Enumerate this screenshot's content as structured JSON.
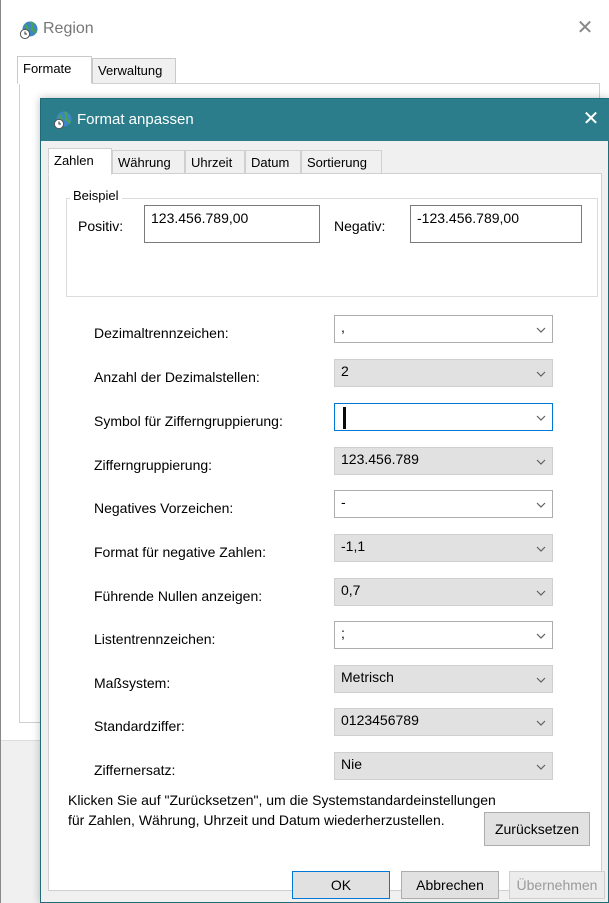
{
  "region": {
    "title": "Region",
    "tabs": [
      {
        "label": "Formate",
        "active": true
      },
      {
        "label": "Verwaltung",
        "active": false
      }
    ]
  },
  "dialog": {
    "title": "Format anpassen",
    "tabs": [
      {
        "label": "Zahlen",
        "active": true
      },
      {
        "label": "Währung",
        "active": false
      },
      {
        "label": "Uhrzeit",
        "active": false
      },
      {
        "label": "Datum",
        "active": false
      },
      {
        "label": "Sortierung",
        "active": false
      }
    ],
    "example": {
      "group_label": "Beispiel",
      "positive_label": "Positiv:",
      "positive_value": "123.456.789,00",
      "negative_label": "Negativ:",
      "negative_value": "-123.456.789,00"
    },
    "settings": [
      {
        "label": "Dezimaltrennzeichen:",
        "value": ",",
        "style": "white"
      },
      {
        "label": "Anzahl der Dezimalstellen:",
        "value": "2",
        "style": "gray"
      },
      {
        "label": "Symbol für Zifferngruppierung:",
        "value": "",
        "style": "focus"
      },
      {
        "label": "Zifferngruppierung:",
        "value": "123.456.789",
        "style": "gray"
      },
      {
        "label": "Negatives Vorzeichen:",
        "value": "-",
        "style": "white"
      },
      {
        "label": "Format für negative Zahlen:",
        "value": "-1,1",
        "style": "gray"
      },
      {
        "label": "Führende Nullen anzeigen:",
        "value": "0,7",
        "style": "gray"
      },
      {
        "label": "Listentrennzeichen:",
        "value": ";",
        "style": "white"
      },
      {
        "label": "Maßsystem:",
        "value": "Metrisch",
        "style": "gray"
      },
      {
        "label": "Standardziffer:",
        "value": "0123456789",
        "style": "gray"
      },
      {
        "label": "Ziffernersatz:",
        "value": "Nie",
        "style": "gray"
      }
    ],
    "reset_text": "Klicken Sie auf \"Zurücksetzen\", um die Systemstandardeinstellungen für Zahlen, Währung, Uhrzeit und Datum wiederherzustellen.",
    "buttons": {
      "reset": "Zurücksetzen",
      "ok": "OK",
      "cancel": "Abbrechen",
      "apply": "Übernehmen"
    }
  },
  "icons": {
    "app": "globe-clock-icon",
    "close": "close-icon",
    "dropdown": "chevron-down-icon"
  },
  "colors": {
    "dialog_titlebar": "#2b7d8b",
    "focus_border": "#0078d7",
    "panel_bg": "#f0f0f0"
  }
}
